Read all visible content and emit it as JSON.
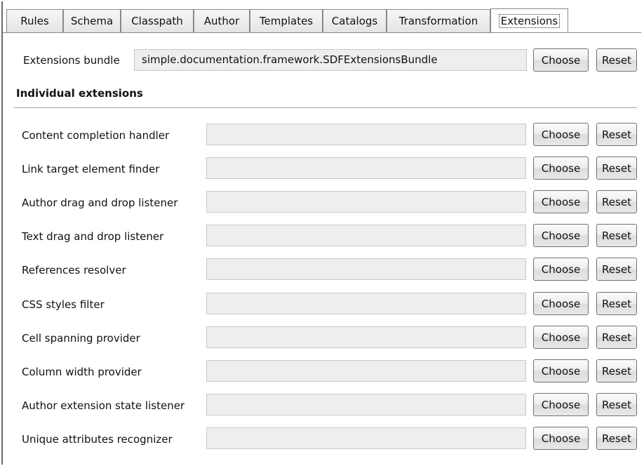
{
  "tabs": [
    {
      "label": "Rules",
      "active": false
    },
    {
      "label": "Schema",
      "active": false
    },
    {
      "label": "Classpath",
      "active": false
    },
    {
      "label": "Author",
      "active": false
    },
    {
      "label": "Templates",
      "active": false
    },
    {
      "label": "Catalogs",
      "active": false
    },
    {
      "label": "Transformation",
      "active": false
    },
    {
      "label": "Extensions",
      "active": true
    }
  ],
  "bundle": {
    "label": "Extensions bundle",
    "value": "simple.documentation.framework.SDFExtensionsBundle",
    "choose_label": "Choose",
    "reset_label": "Reset"
  },
  "section": {
    "title": "Individual extensions"
  },
  "extensions": [
    {
      "label": "Content completion handler",
      "value": "",
      "choose_label": "Choose",
      "reset_label": "Reset"
    },
    {
      "label": "Link target element finder",
      "value": "",
      "choose_label": "Choose",
      "reset_label": "Reset"
    },
    {
      "label": "Author drag and drop listener",
      "value": "",
      "choose_label": "Choose",
      "reset_label": "Reset"
    },
    {
      "label": "Text drag and drop listener",
      "value": "",
      "choose_label": "Choose",
      "reset_label": "Reset"
    },
    {
      "label": "References resolver",
      "value": "",
      "choose_label": "Choose",
      "reset_label": "Reset"
    },
    {
      "label": "CSS styles filter",
      "value": "",
      "choose_label": "Choose",
      "reset_label": "Reset"
    },
    {
      "label": "Cell spanning provider",
      "value": "",
      "choose_label": "Choose",
      "reset_label": "Reset"
    },
    {
      "label": "Column width provider",
      "value": "",
      "choose_label": "Choose",
      "reset_label": "Reset"
    },
    {
      "label": "Author extension state listener",
      "value": "",
      "choose_label": "Choose",
      "reset_label": "Reset"
    },
    {
      "label": "Unique attributes recognizer",
      "value": "",
      "choose_label": "Choose",
      "reset_label": "Reset"
    }
  ]
}
